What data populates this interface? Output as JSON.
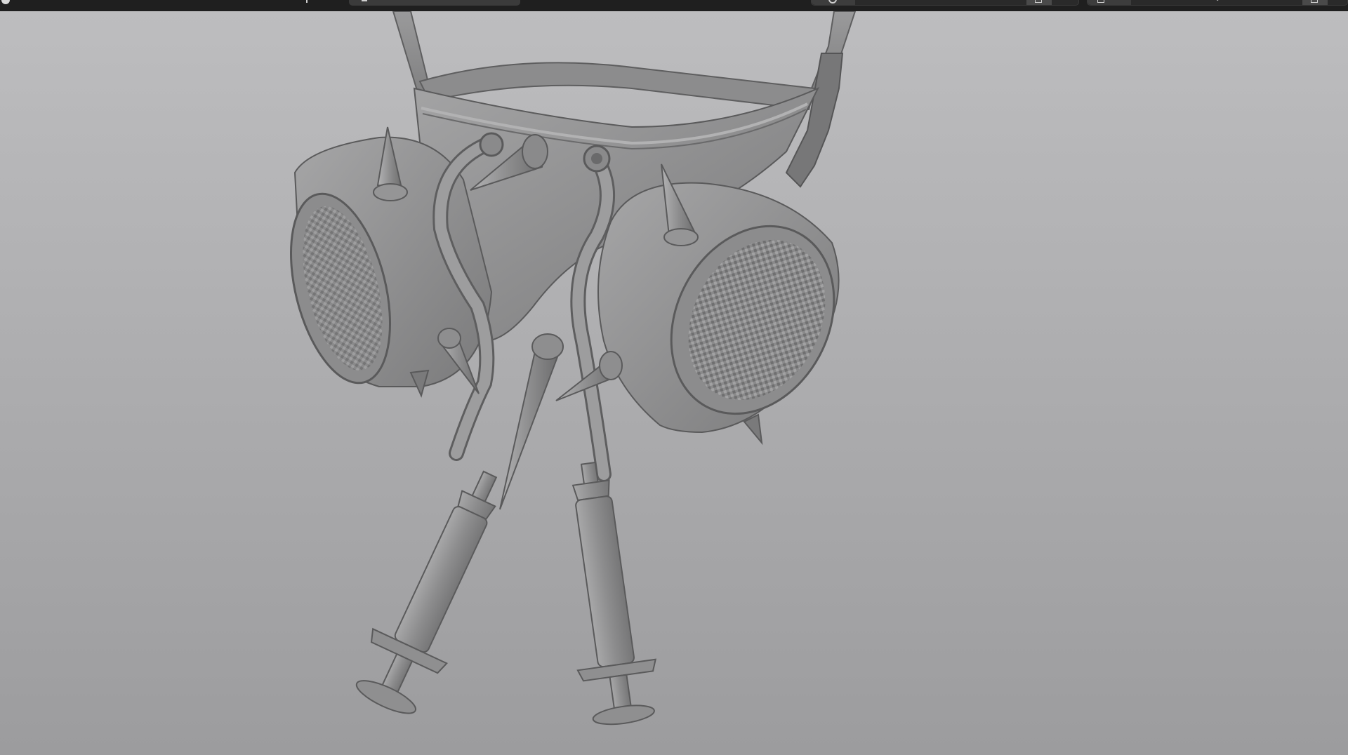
{
  "app": {
    "viewport_label": "",
    "colors": {
      "toolbar_bg": "#1f1f1f",
      "viewport_top": "#bdbdbf",
      "viewport_bottom": "#9c9c9e",
      "model_base": "#8e8e8f"
    }
  },
  "toolbar": {
    "menu_icon": "circle-icon",
    "transform_icon": "move-icon",
    "search_icon": "search-icon",
    "view_icon": "refresh-icon",
    "layer_icon": "layer-icon",
    "panel_icon": "panel-icon",
    "field_text": "y"
  },
  "scene": {
    "model_name": "",
    "icons": {
      "model": "gas-mask-model"
    }
  }
}
